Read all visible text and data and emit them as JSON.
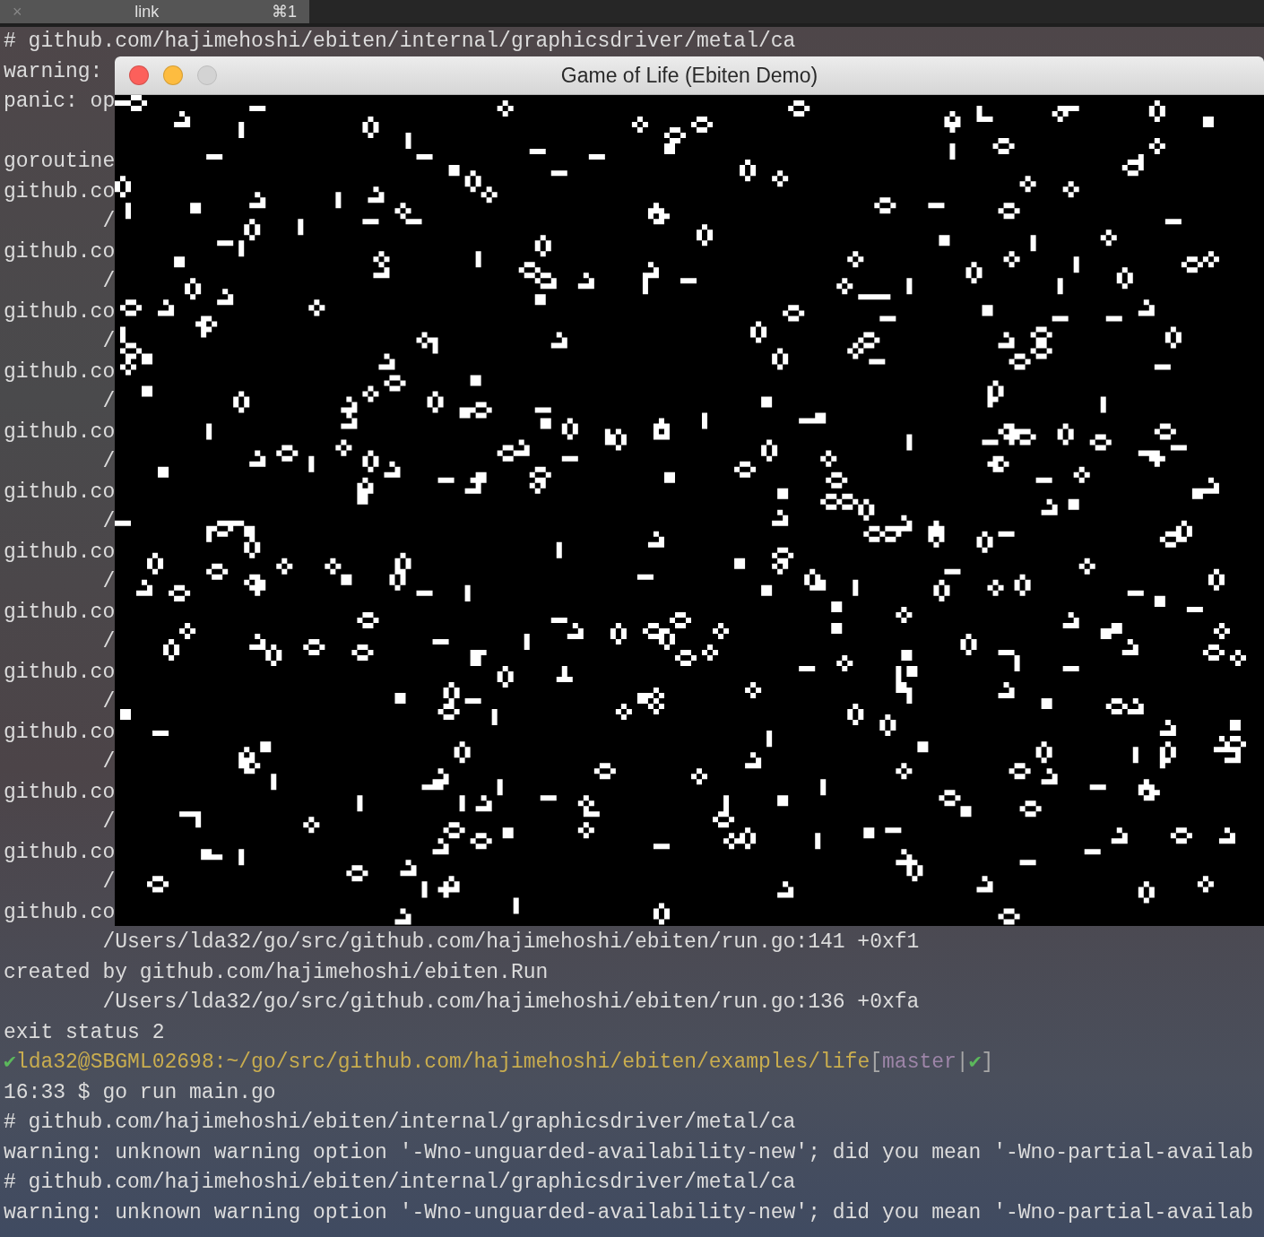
{
  "tab_bar": {
    "tabs": [
      {
        "close": "×",
        "label": "link",
        "shortcut": "⌘1",
        "selected": true
      }
    ]
  },
  "terminal": {
    "lines": [
      {
        "kind": "plain",
        "text": "# github.com/hajimehoshi/ebiten/internal/graphicsdriver/metal/ca"
      },
      {
        "kind": "plain",
        "text": "warning:"
      },
      {
        "kind": "plain",
        "text": "panic: op"
      },
      {
        "kind": "blank"
      },
      {
        "kind": "plain",
        "text": "goroutine"
      },
      {
        "kind": "plain",
        "text": "github.co"
      },
      {
        "kind": "indent",
        "text": "/"
      },
      {
        "kind": "plain",
        "text": "github.co"
      },
      {
        "kind": "indent",
        "text": "/"
      },
      {
        "kind": "plain",
        "text": "github.co"
      },
      {
        "kind": "indent",
        "text": "/"
      },
      {
        "kind": "plain",
        "text": "github.co"
      },
      {
        "kind": "indent",
        "text": "/"
      },
      {
        "kind": "plain",
        "text": "github.co"
      },
      {
        "kind": "indent",
        "text": "/"
      },
      {
        "kind": "plain",
        "text": "github.co"
      },
      {
        "kind": "indent",
        "text": "/"
      },
      {
        "kind": "plain",
        "text": "github.co"
      },
      {
        "kind": "indent",
        "text": "/"
      },
      {
        "kind": "plain",
        "text": "github.co"
      },
      {
        "kind": "indent",
        "text": "/"
      },
      {
        "kind": "plain",
        "text": "github.co"
      },
      {
        "kind": "indent",
        "text": "/"
      },
      {
        "kind": "plain",
        "text": "github.co"
      },
      {
        "kind": "indent",
        "text": "/"
      },
      {
        "kind": "plain",
        "text": "github.co"
      },
      {
        "kind": "indent",
        "text": "/"
      },
      {
        "kind": "plain",
        "text": "github.co"
      },
      {
        "kind": "indent",
        "text": "/"
      },
      {
        "kind": "plain",
        "text": "github.co"
      },
      {
        "kind": "indent",
        "text": "/Users/lda32/go/src/github.com/hajimehoshi/ebiten/run.go:141 +0xf1"
      },
      {
        "kind": "plain",
        "text": "created by github.com/hajimehoshi/ebiten.Run"
      },
      {
        "kind": "indent",
        "text": "/Users/lda32/go/src/github.com/hajimehoshi/ebiten/run.go:136 +0xfa"
      },
      {
        "kind": "plain",
        "text": "exit status 2"
      },
      {
        "kind": "prompt",
        "segments": [
          {
            "kind": "check",
            "text": "✔"
          },
          {
            "kind": "path",
            "text": "lda32@SBGML02698:~/go/src/github.com/hajimehoshi/ebiten/examples/life"
          },
          {
            "kind": "bracket",
            "text": "["
          },
          {
            "kind": "branch",
            "text": "master"
          },
          {
            "kind": "bracket",
            "text": "|"
          },
          {
            "kind": "check",
            "text": "✔"
          },
          {
            "kind": "bracket",
            "text": "]"
          }
        ]
      },
      {
        "kind": "plain",
        "text": "16:33 $ go run main.go"
      },
      {
        "kind": "plain",
        "text": "# github.com/hajimehoshi/ebiten/internal/graphicsdriver/metal/ca"
      },
      {
        "kind": "plain",
        "text": "warning: unknown warning option '-Wno-unguarded-availability-new'; did you mean '-Wno-partial-availab"
      },
      {
        "kind": "plain",
        "text": "# github.com/hajimehoshi/ebiten/internal/graphicsdriver/metal/ca"
      },
      {
        "kind": "plain",
        "text": "warning: unknown warning option '-Wno-unguarded-availability-new'; did you mean '-Wno-partial-availab"
      }
    ]
  },
  "game_window": {
    "title": "Game of Life (Ebiten Demo)",
    "buttons": [
      {
        "kind": "close",
        "disabled": false
      },
      {
        "kind": "minimize",
        "disabled": false
      },
      {
        "kind": "zoom",
        "disabled": true
      }
    ]
  }
}
